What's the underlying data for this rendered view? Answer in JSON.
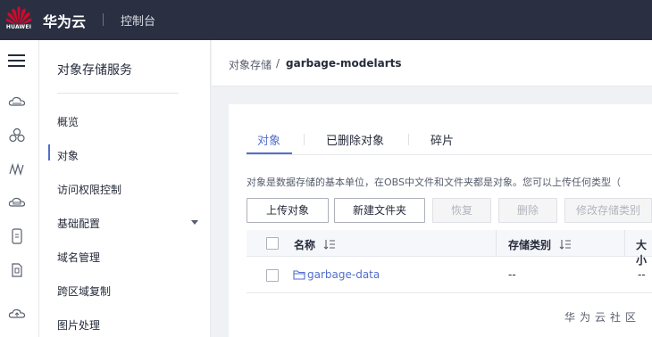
{
  "header": {
    "logo_text": "HUAWEI",
    "brand": "华为云",
    "console": "控制台"
  },
  "rail": {
    "icons": [
      "menu-icon",
      "cloud-drive-icon",
      "nodes-icon",
      "stack-icon",
      "cloud-db-icon",
      "phone-icon",
      "document-icon",
      "cloud-upload-icon"
    ]
  },
  "nav": {
    "title": "对象存储服务",
    "items": [
      {
        "label": "概览"
      },
      {
        "label": "对象"
      },
      {
        "label": "访问权限控制"
      },
      {
        "label": "基础配置"
      },
      {
        "label": "域名管理"
      },
      {
        "label": "跨区域复制"
      },
      {
        "label": "图片处理"
      }
    ],
    "active_index": 1
  },
  "breadcrumb": {
    "root": "对象存储",
    "separator": "/",
    "current": "garbage-modelarts"
  },
  "tabs": [
    {
      "label": "对象"
    },
    {
      "label": "已删除对象"
    },
    {
      "label": "碎片"
    }
  ],
  "description": "对象是数据存储的基本单位，在OBS中文件和文件夹都是对象。您可以上传任何类型（",
  "toolbar": {
    "upload": "上传对象",
    "new_folder": "新建文件夹",
    "restore": "恢复",
    "delete": "删除",
    "change_storage": "修改存储类别"
  },
  "table": {
    "columns": [
      "名称",
      "存储类别",
      "大小"
    ],
    "rows": [
      {
        "name": "garbage-data",
        "storage_class": "--",
        "size": "--"
      }
    ]
  },
  "footer": {
    "brand": "华为云社区"
  },
  "colors": {
    "topbar": "#2a3042",
    "accent": "#526ecc",
    "logo_red": "#cf0a2c"
  }
}
